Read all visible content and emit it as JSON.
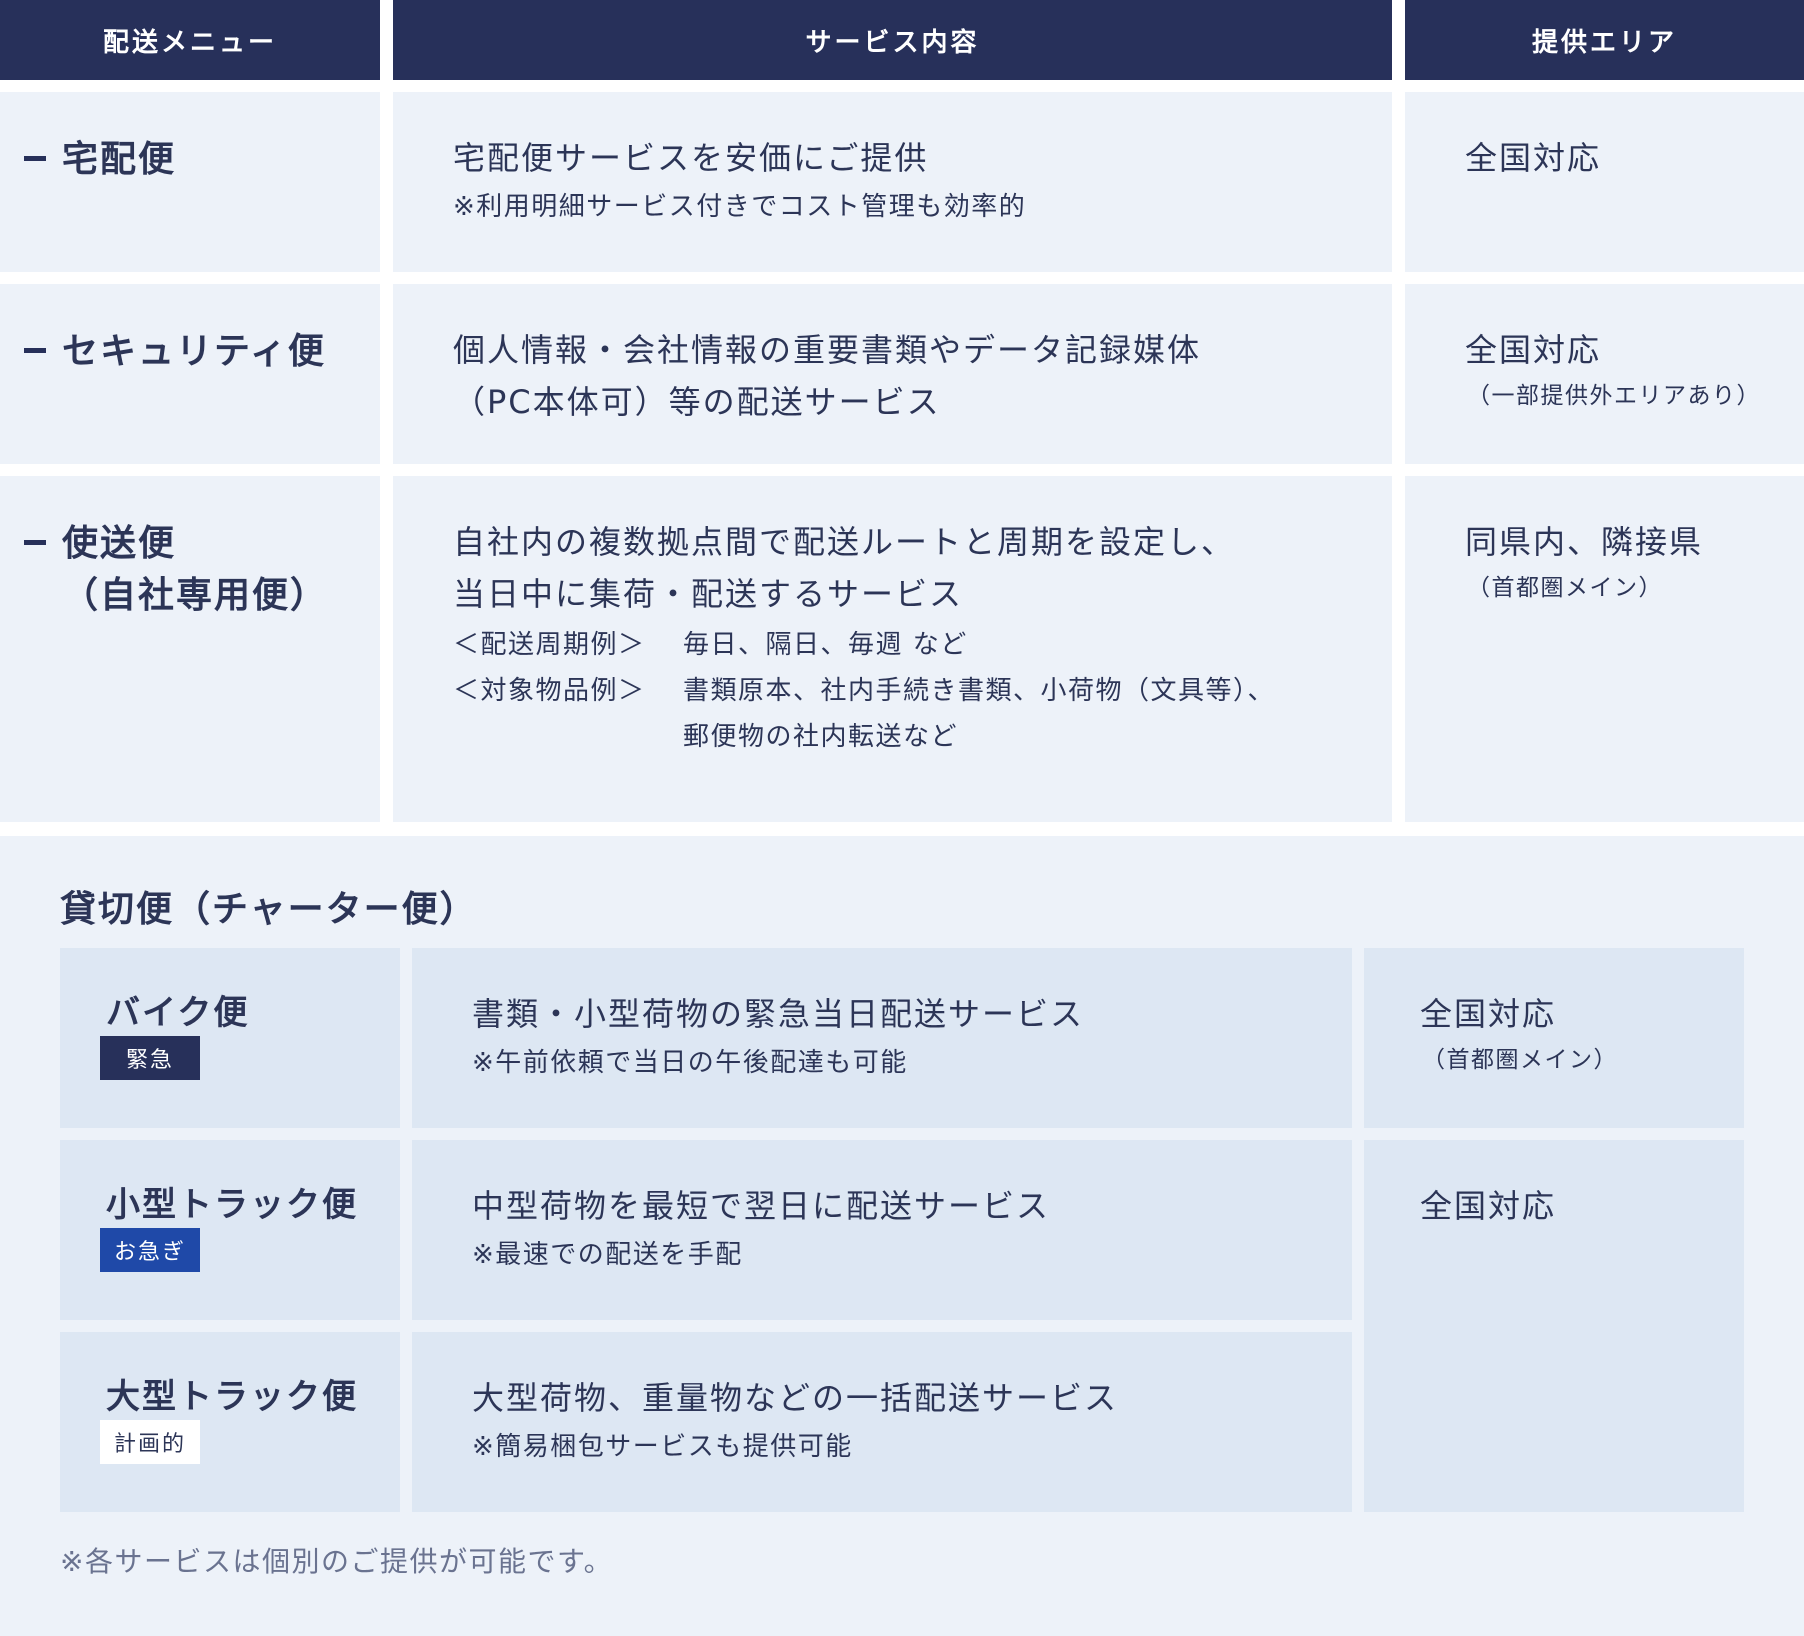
{
  "header": {
    "col_menu": "配送メニュー",
    "col_service": "サービス内容",
    "col_area": "提供エリア"
  },
  "rows": [
    {
      "name": "宅配便",
      "desc_lines": [
        "宅配便サービスを安価にご提供"
      ],
      "note": "※利用明細サービス付きでコスト管理も効率的",
      "area": "全国対応",
      "area_note": ""
    },
    {
      "name": "セキュリティ便",
      "desc_lines": [
        "個人情報・会社情報の重要書類やデータ記録媒体",
        "（PC本体可）等の配送サービス"
      ],
      "area": "全国対応",
      "area_note": "（一部提供外エリアあり）"
    },
    {
      "name": "使送便",
      "name_sub": "（自社専用便）",
      "desc_lines": [
        "自社内の複数拠点間で配送ルートと周期を設定し、",
        "当日中に集荷・配送するサービス"
      ],
      "examples": [
        {
          "label": "＜配送周期例＞",
          "lines": [
            "毎日、隔日、毎週 など"
          ]
        },
        {
          "label": "＜対象物品例＞",
          "lines": [
            "書類原本、社内手続き書類、小荷物（文具等）、",
            "郵便物の社内転送など"
          ]
        }
      ],
      "area": "同県内、隣接県",
      "area_note": "（首都圏メイン）"
    }
  ],
  "charter": {
    "title": "貸切便（チャーター便）",
    "rows": [
      {
        "name": "バイク便",
        "badge": "緊急",
        "desc": "書類・小型荷物の緊急当日配送サービス",
        "note": "※午前依頼で当日の午後配達も可能",
        "area": "全国対応",
        "area_note": "（首都圏メイン）"
      },
      {
        "name": "小型トラック便",
        "badge": "お急ぎ",
        "desc": "中型荷物を最短で翌日に配送サービス",
        "note": "※最速での配送を手配"
      },
      {
        "name": "大型トラック便",
        "badge": "計画的",
        "desc": "大型荷物、重量物などの一括配送サービス",
        "note": "※簡易梱包サービスも提供可能"
      }
    ],
    "shared_area": "全国対応",
    "footnote": "※各サービスは個別のご提供が可能です。"
  },
  "colors": {
    "header_bg": "#27305a",
    "cell_bg": "#edf2f9",
    "charter_cell_bg": "#dde7f3",
    "badge_urgent": "#27305a",
    "badge_hurry": "#1f49a8",
    "badge_planned": "#ffffff",
    "text": "#2c3557"
  }
}
